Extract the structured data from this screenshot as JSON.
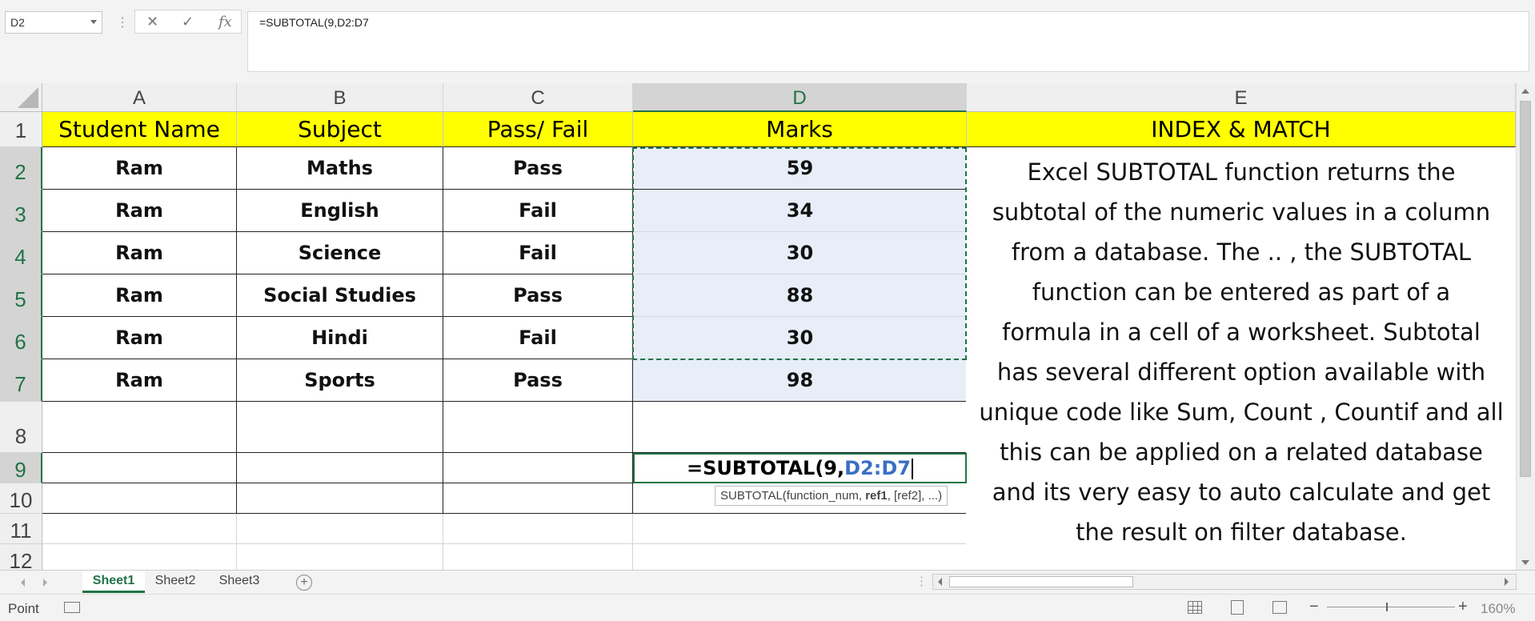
{
  "formula_bar": {
    "name_box": "D2",
    "formula": "=SUBTOTAL(9,D2:D7",
    "cancel_icon": "x-icon",
    "enter_icon": "check-icon",
    "fx_label": "fx"
  },
  "columns": [
    "A",
    "B",
    "C",
    "D",
    "E"
  ],
  "rows": [
    "1",
    "2",
    "3",
    "4",
    "5",
    "6",
    "7",
    "8",
    "9",
    "10",
    "11",
    "12"
  ],
  "header_row": {
    "a": "Student Name",
    "b": "Subject",
    "c": "Pass/ Fail",
    "d": "Marks",
    "e": "INDEX & MATCH"
  },
  "records": [
    {
      "name": "Ram",
      "subject": "Maths",
      "result": "Pass",
      "marks": "59"
    },
    {
      "name": "Ram",
      "subject": "English",
      "result": "Fail",
      "marks": "34"
    },
    {
      "name": "Ram",
      "subject": "Science",
      "result": "Fail",
      "marks": "30"
    },
    {
      "name": "Ram",
      "subject": "Social Studies",
      "result": "Pass",
      "marks": "88"
    },
    {
      "name": "Ram",
      "subject": "Hindi",
      "result": "Fail",
      "marks": "30"
    },
    {
      "name": "Ram",
      "subject": "Sports",
      "result": "Pass",
      "marks": "98"
    }
  ],
  "description_lines": [
    "Excel SUBTOTAL function returns the",
    "subtotal of the numeric values in a column",
    "from a database. The .. , the SUBTOTAL",
    "function can be entered as part of a",
    "formula in a cell of a worksheet. Subtotal",
    "has several different option available with",
    "unique code like Sum, Count , Countif and all",
    "this can be applied on a related database",
    "and its very easy to auto calculate and get",
    "the result on filter database."
  ],
  "editing_cell": {
    "prefix": "=SUBTOTAL(9,",
    "ref": "D2:D7"
  },
  "tooltip": {
    "start": "SUBTOTAL(function_num, ",
    "bold": "ref1",
    "end": ", [ref2], ...)"
  },
  "sheet_tabs": [
    "Sheet1",
    "Sheet2",
    "Sheet3"
  ],
  "active_sheet": "Sheet1",
  "status": {
    "mode": "Point",
    "zoom": "160%"
  },
  "colors": {
    "accent": "#217346",
    "header_fill": "#ffff00",
    "reference": "#3a6fc4"
  }
}
